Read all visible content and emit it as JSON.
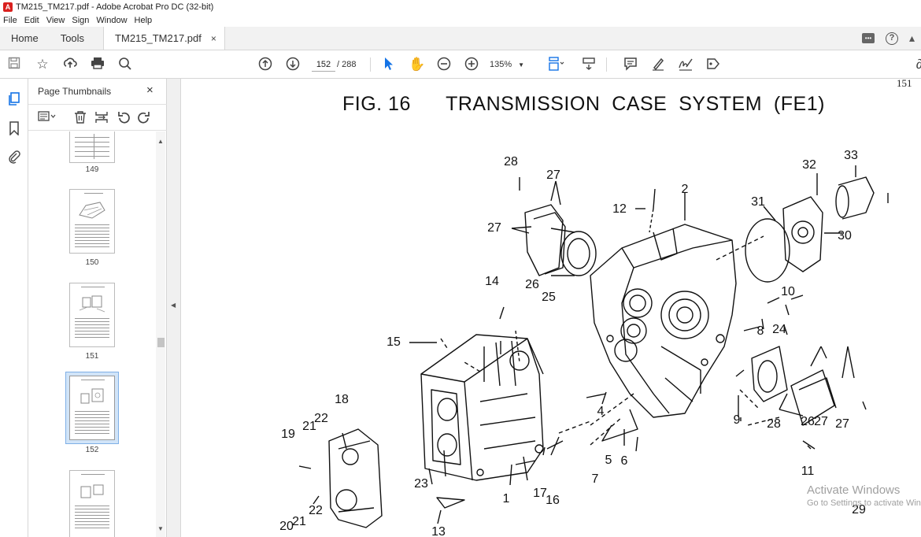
{
  "window": {
    "title": "TM215_TM217.pdf - Adobe Acrobat Pro DC (32-bit)",
    "app_icon_glyph": "A"
  },
  "menu": {
    "items": [
      "File",
      "Edit",
      "View",
      "Sign",
      "Window",
      "Help"
    ]
  },
  "tabs": {
    "home": "Home",
    "tools": "Tools",
    "document": "TM215_TM217.pdf",
    "close_glyph": "×"
  },
  "toolbar": {
    "current_page": "152",
    "total_pages": "/ 288",
    "zoom": "135%"
  },
  "panel": {
    "title": "Page Thumbnails",
    "close_glyph": "×"
  },
  "thumbnails": [
    {
      "label": "149"
    },
    {
      "label": "150"
    },
    {
      "label": "151"
    },
    {
      "label": "152",
      "selected": true
    },
    {
      "label": ""
    }
  ],
  "document": {
    "page_number": "151",
    "figure_title": "FIG. 16      TRANSMISSION  CASE  SYSTEM  (FE1)",
    "callouts": [
      "1",
      "2",
      "4",
      "5",
      "6",
      "7",
      "8",
      "9",
      "10",
      "11",
      "12",
      "13",
      "14",
      "15",
      "16",
      "17",
      "18",
      "19",
      "20",
      "21",
      "21",
      "22",
      "22",
      "23",
      "24",
      "25",
      "26",
      "26",
      "27",
      "27",
      "27",
      "27",
      "28",
      "28",
      "29",
      "30",
      "31",
      "32",
      "33"
    ]
  },
  "watermark": {
    "line1": "Activate Windows",
    "line2": "Go to Settings to activate Windows."
  },
  "colors": {
    "accent": "#1473e6",
    "selection": "#d1e4f8",
    "tab_bg": "#f2f2f2"
  }
}
